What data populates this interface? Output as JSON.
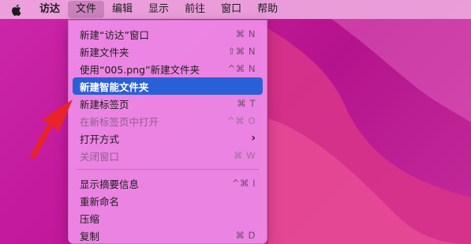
{
  "menubar": {
    "items": [
      {
        "label": "访达",
        "bold": true
      },
      {
        "label": "文件",
        "active": true
      },
      {
        "label": "编辑"
      },
      {
        "label": "显示"
      },
      {
        "label": "前往"
      },
      {
        "label": "窗口"
      },
      {
        "label": "帮助"
      }
    ]
  },
  "file_menu": {
    "groups": [
      [
        {
          "label": "新建“访达”窗口",
          "shortcut": "⌘ N"
        },
        {
          "label": "新建文件夹",
          "shortcut": "⇧⌘ N"
        },
        {
          "label": "使用“005.png”新建文件夹",
          "shortcut": "^⌘ N"
        },
        {
          "label": "新建智能文件夹",
          "selected": true
        },
        {
          "label": "新建标签页",
          "shortcut": "⌘ T"
        },
        {
          "label": "在新标签页中打开",
          "shortcut": "^⌘ O",
          "disabled": true
        },
        {
          "label": "打开方式",
          "submenu": true
        },
        {
          "label": "关闭窗口",
          "shortcut": "⌘ W",
          "disabled": true
        }
      ],
      [
        {
          "label": "显示摘要信息",
          "shortcut": "^⌘ I"
        },
        {
          "label": "重新命名"
        },
        {
          "label": "压缩"
        },
        {
          "label": "复制",
          "shortcut": "⌘ D"
        }
      ]
    ]
  },
  "icons": {
    "apple": "apple-logo-icon",
    "submenu": "chevron-right-icon",
    "arrow": "red-arrow-icon"
  },
  "colors": {
    "highlight": "#2a60d6",
    "arrow": "#e8232a",
    "wallpaper": "#c21996"
  }
}
